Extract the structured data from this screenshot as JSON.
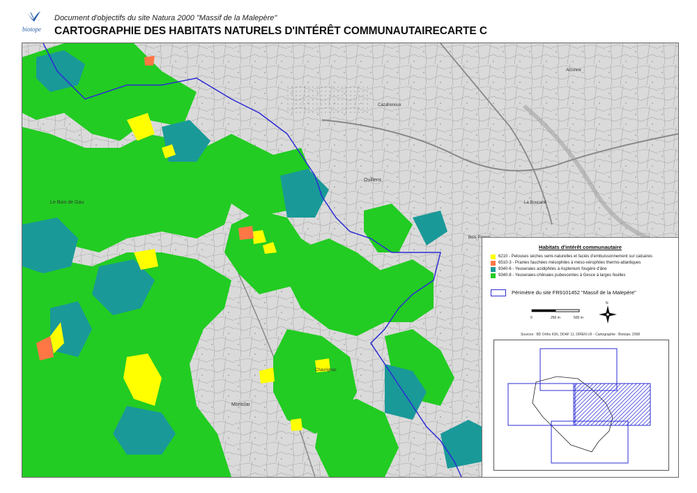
{
  "header": {
    "subtitle": "Document d'objectifs du site Natura 2000 \"Massif de la Malepère\"",
    "title": "CARTOGRAPHIE DES HABITATS NATURELS D'INTÉRÊT COMMUNAUTAIRECARTE C",
    "logo_text": "biotope"
  },
  "map": {
    "place_labels": [
      "Le Bois de Gau",
      "Ouillens",
      "Montclar",
      "Cazalrenoux",
      "Alzonne",
      "La Boucarié",
      "Chaurignac",
      "Bois Pierrel"
    ],
    "colors": {
      "background": "#dcdcdc",
      "forest": "#22cc22",
      "teal": "#1a9999",
      "yellow": "#ffff00",
      "orange": "#ff7744",
      "perimeter": "#2b2bd4"
    }
  },
  "legend": {
    "title": "Habitats d'intérêt communautaire",
    "items": [
      {
        "color": "#ffff00",
        "label": "6210 - Pelouses sèches semi-naturelles et faciès d'embuissonnement sur calcaires"
      },
      {
        "color": "#ff7744",
        "label": "6510-3 - Prairies fauchées mésophiles à méso-xérophiles thermo-atlantiques"
      },
      {
        "color": "#1a9999",
        "label": "9340-6 - Yeuseraies acidiphiles à Asplenium fougère d'âne"
      },
      {
        "color": "#22cc22",
        "label": "9340-8 - Yeuseraies-chênaies pubescentes à Gesce à larges feuilles"
      }
    ],
    "perimeter_label": "Périmètre du site FR9101452 \"Massif de la Malepère\"",
    "scale": {
      "ticks": [
        "0",
        "250 m",
        "500 m"
      ]
    },
    "north_label": "N",
    "sources": "Sources : BD Ortho IGN, DDAF 11, DIREN LR - Cartographie : Biotope, 2008"
  }
}
